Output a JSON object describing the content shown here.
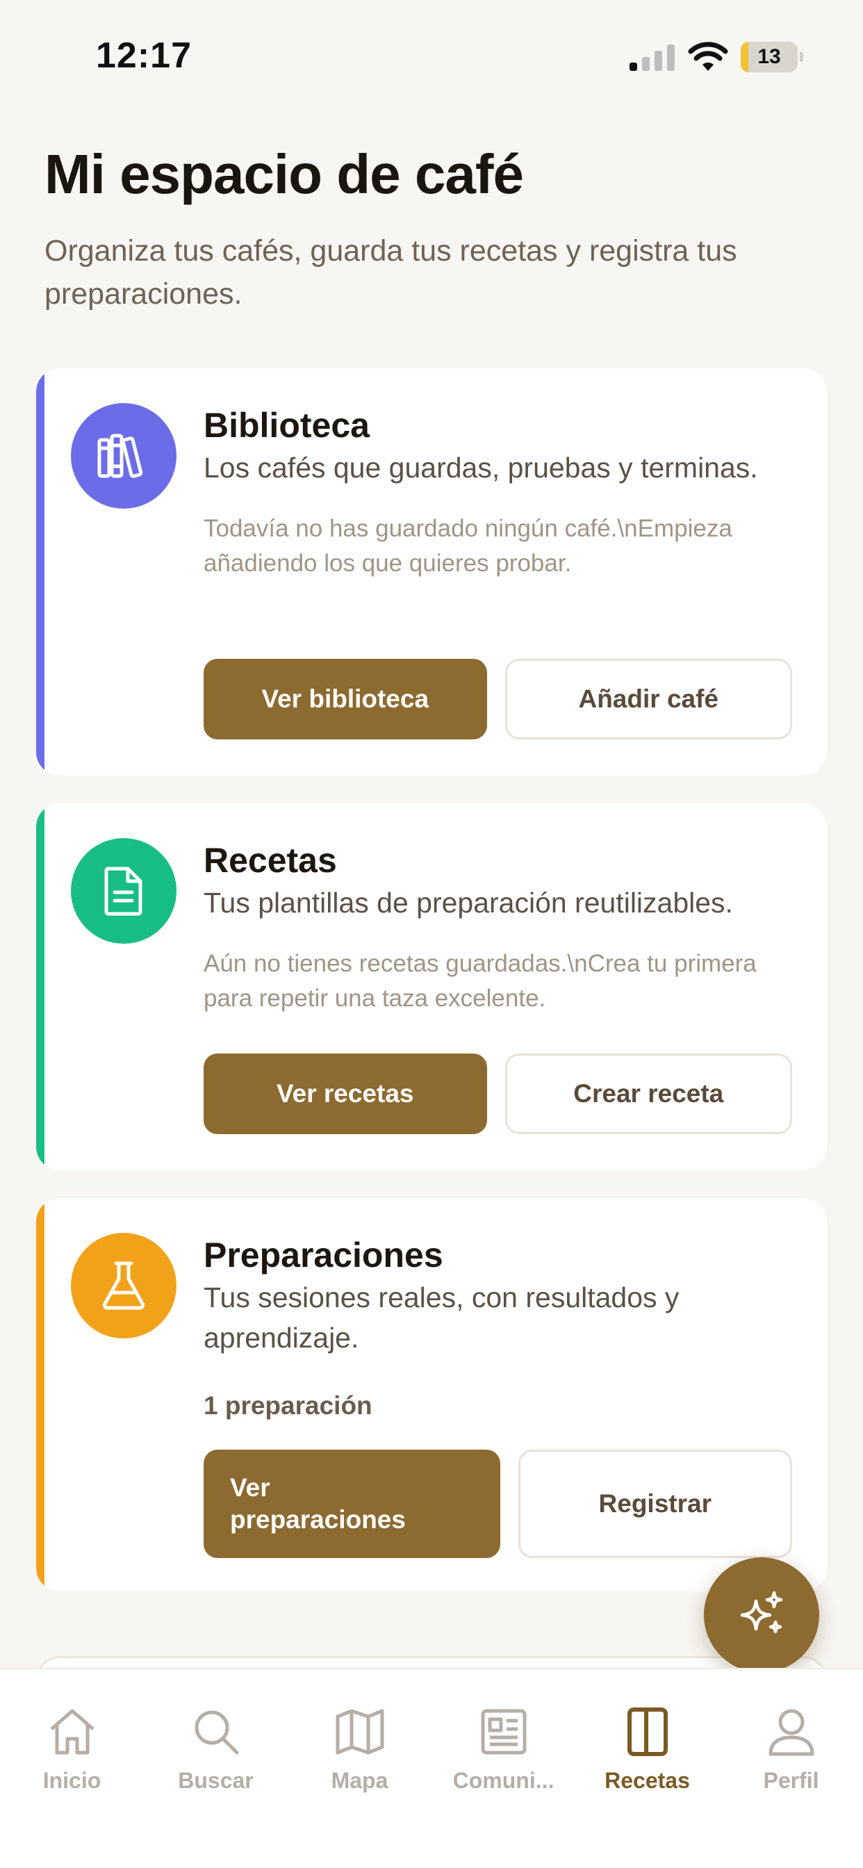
{
  "status_bar": {
    "time": "12:17",
    "battery": "13",
    "battery_level_pct": 13
  },
  "header": {
    "title": "Mi espacio de café",
    "subtitle": "Organiza tus cafés, guarda tus recetas y registra tus preparaciones."
  },
  "cards": [
    {
      "title": "Biblioteca",
      "description": "Los cafés que guardas, pruebas y terminas.",
      "empty_text": "Todavía no has guardado ningún café.\\nEmpieza añadiendo los que quieres probar.",
      "primary_label": "Ver biblioteca",
      "secondary_label": "Añadir café",
      "accent_color": "#6c6ce8",
      "icon": "books-icon"
    },
    {
      "title": "Recetas",
      "description": "Tus plantillas de preparación reutilizables.",
      "empty_text": "Aún no tienes recetas guardadas.\\nCrea tu primera para repetir una taza excelente.",
      "primary_label": "Ver recetas",
      "secondary_label": "Crear receta",
      "accent_color": "#17bd84",
      "icon": "document-icon"
    },
    {
      "title": "Preparaciones",
      "description": "Tus sesiones reales, con resultados y aprendizaje.",
      "count_text": "1 preparación",
      "primary_label": "Ver preparaciones",
      "secondary_label": "Registrar",
      "accent_color": "#f2a219",
      "icon": "flask-icon"
    }
  ],
  "fab": {
    "icon": "sparkles-icon"
  },
  "tab_bar": {
    "active": "Recetas",
    "brand_color": "#8c6a30",
    "tabs": [
      {
        "label": "Inicio",
        "icon": "home-icon"
      },
      {
        "label": "Buscar",
        "icon": "search-icon"
      },
      {
        "label": "Mapa",
        "icon": "map-icon"
      },
      {
        "label": "Comuni...",
        "icon": "newspaper-icon"
      },
      {
        "label": "Recetas",
        "icon": "book-icon"
      },
      {
        "label": "Perfil",
        "icon": "user-icon"
      }
    ]
  }
}
